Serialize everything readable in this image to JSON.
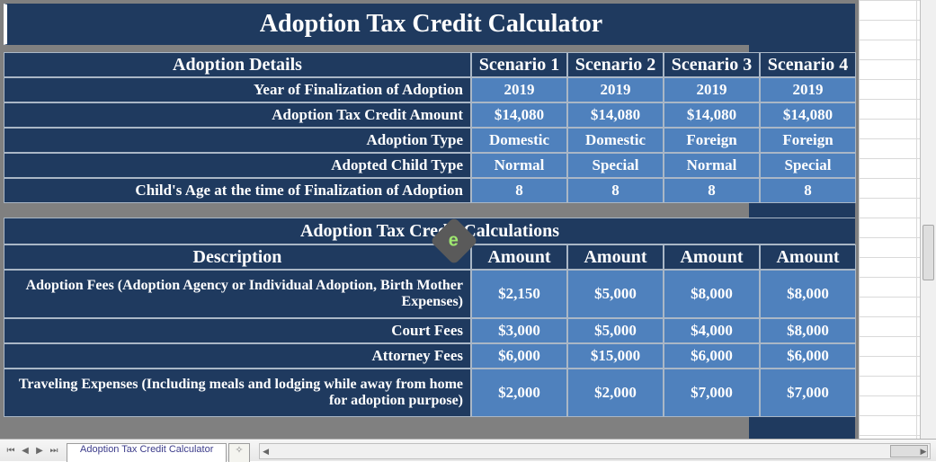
{
  "title": "Adoption Tax Credit Calculator",
  "details": {
    "header_label": "Adoption Details",
    "scenario_labels": [
      "Scenario 1",
      "Scenario 2",
      "Scenario 3",
      "Scenario 4"
    ],
    "rows": [
      {
        "label": "Year of Finalization of Adoption",
        "vals": [
          "2019",
          "2019",
          "2019",
          "2019"
        ]
      },
      {
        "label": "Adoption Tax Credit Amount",
        "vals": [
          "$14,080",
          "$14,080",
          "$14,080",
          "$14,080"
        ]
      },
      {
        "label": "Adoption Type",
        "vals": [
          "Domestic",
          "Domestic",
          "Foreign",
          "Foreign"
        ]
      },
      {
        "label": "Adopted Child Type",
        "vals": [
          "Normal",
          "Special",
          "Normal",
          "Special"
        ]
      },
      {
        "label": "Child's Age at the time of Finalization of Adoption",
        "vals": [
          "8",
          "8",
          "8",
          "8"
        ]
      }
    ]
  },
  "calc": {
    "section_title": "Adoption Tax Credit Calculations",
    "header_label": "Description",
    "amount_labels": [
      "Amount",
      "Amount",
      "Amount",
      "Amount"
    ],
    "rows": [
      {
        "label": "Adoption Fees (Adoption Agency or Individual Adoption, Birth Mother Expenses)",
        "wrap": true,
        "vals": [
          "$2,150",
          "$5,000",
          "$8,000",
          "$8,000"
        ]
      },
      {
        "label": "Court Fees",
        "wrap": false,
        "vals": [
          "$3,000",
          "$5,000",
          "$4,000",
          "$8,000"
        ]
      },
      {
        "label": "Attorney Fees",
        "wrap": false,
        "vals": [
          "$6,000",
          "$15,000",
          "$6,000",
          "$6,000"
        ]
      },
      {
        "label": "Traveling Expenses (Including meals and lodging while away from home for adoption purpose)",
        "wrap": true,
        "vals": [
          "$2,000",
          "$2,000",
          "$7,000",
          "$7,000"
        ]
      }
    ]
  },
  "tab_name": "Adoption Tax Credit Calculator",
  "watermark": "e"
}
